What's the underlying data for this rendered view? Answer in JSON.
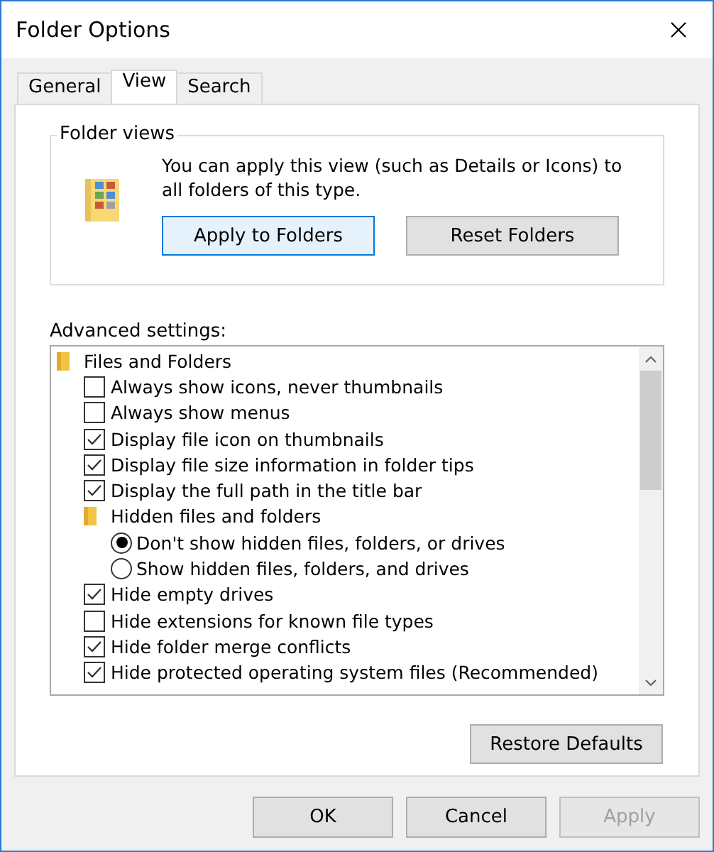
{
  "window": {
    "title": "Folder Options"
  },
  "tabs": [
    {
      "label": "General",
      "selected": false
    },
    {
      "label": "View",
      "selected": true
    },
    {
      "label": "Search",
      "selected": false
    }
  ],
  "folder_views": {
    "title": "Folder views",
    "description": "You can apply this view (such as Details or Icons) to all folders of this type.",
    "buttons": [
      {
        "label": "Apply to Folders",
        "focused": true
      },
      {
        "label": "Reset Folders",
        "focused": false
      }
    ]
  },
  "advanced": {
    "label": "Advanced settings:",
    "items": [
      {
        "kind": "group",
        "label": "Files and Folders",
        "children": [
          {
            "kind": "checkbox",
            "label": "Always show icons, never thumbnails",
            "checked": false
          },
          {
            "kind": "checkbox",
            "label": "Always show menus",
            "checked": false
          },
          {
            "kind": "checkbox",
            "label": "Display file icon on thumbnails",
            "checked": true
          },
          {
            "kind": "checkbox",
            "label": "Display file size information in folder tips",
            "checked": true
          },
          {
            "kind": "checkbox",
            "label": "Display the full path in the title bar",
            "checked": true
          },
          {
            "kind": "group",
            "label": "Hidden files and folders",
            "children": [
              {
                "kind": "radio",
                "label": "Don't show hidden files, folders, or drives",
                "selected": true
              },
              {
                "kind": "radio",
                "label": "Show hidden files, folders, and drives",
                "selected": false
              }
            ]
          },
          {
            "kind": "checkbox",
            "label": "Hide empty drives",
            "checked": true
          },
          {
            "kind": "checkbox",
            "label": "Hide extensions for known file types",
            "checked": false
          },
          {
            "kind": "checkbox",
            "label": "Hide folder merge conflicts",
            "checked": true
          },
          {
            "kind": "checkbox",
            "label": "Hide protected operating system files (Recommended)",
            "checked": true
          }
        ]
      }
    ],
    "restore_button": "Restore Defaults"
  },
  "buttons": [
    {
      "label": "OK",
      "disabled": false
    },
    {
      "label": "Cancel",
      "disabled": false
    },
    {
      "label": "Apply",
      "disabled": true
    }
  ]
}
